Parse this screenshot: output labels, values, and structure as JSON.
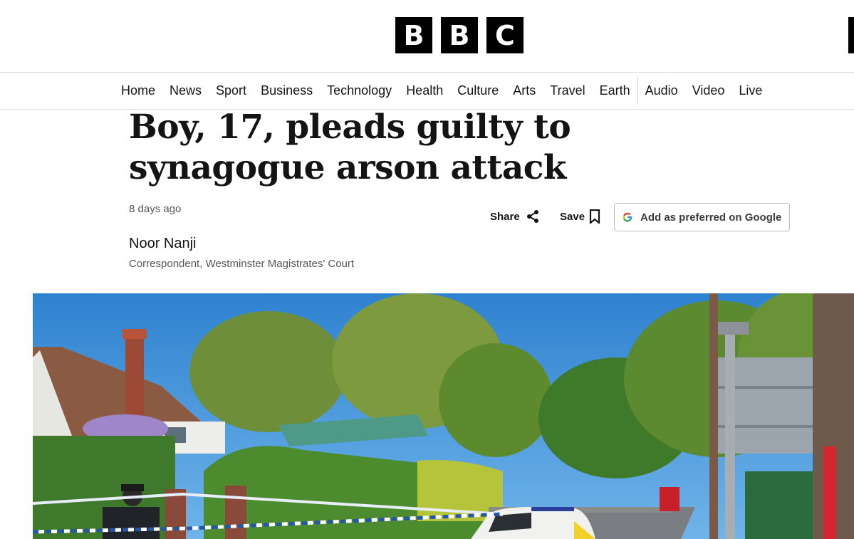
{
  "brand": {
    "letters": [
      "B",
      "B",
      "C"
    ]
  },
  "nav": {
    "items": [
      "Home",
      "News",
      "Sport",
      "Business",
      "Technology",
      "Health",
      "Culture",
      "Arts",
      "Travel",
      "Earth"
    ],
    "media_items": [
      "Audio",
      "Video",
      "Live"
    ]
  },
  "article": {
    "headline": "Boy, 17, pleads guilty to synagogue arson attack",
    "timestamp": "8 days ago",
    "author": "Noor Nanji",
    "author_role": "Correspondent, Westminster Magistrates' Court"
  },
  "actions": {
    "share_label": "Share",
    "save_label": "Save",
    "google_label": "Add as preferred on Google"
  },
  "icons": {
    "share": "share-icon",
    "save": "bookmark-icon",
    "google": "google-g-icon"
  },
  "colors": {
    "brand_black": "#000000",
    "text": "#141414",
    "muted": "#545658",
    "sky": "#3f8fd6",
    "tape": "#2656a8"
  }
}
